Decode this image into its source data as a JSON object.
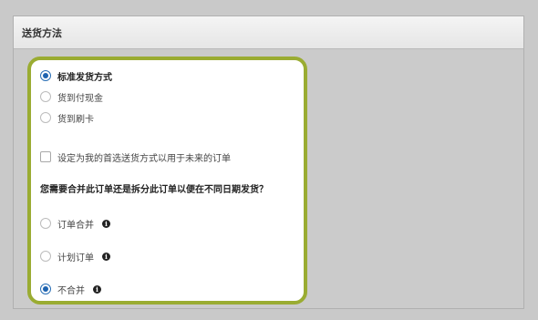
{
  "panel": {
    "title": "送货方法"
  },
  "shipping_options": [
    {
      "label": "标准发货方式",
      "checked": true
    },
    {
      "label": "货到付现金",
      "checked": false
    },
    {
      "label": "货到刷卡",
      "checked": false
    }
  ],
  "preferred_checkbox": {
    "label": "设定为我的首选送货方式以用于未来的订单",
    "checked": false
  },
  "split_question": "您需要合并此订单还是拆分此订单以便在不同日期发货？",
  "split_options": [
    {
      "label": "订单合并",
      "checked": false,
      "icon": "info-icon"
    },
    {
      "label": "计划订单",
      "checked": false,
      "icon": "info-icon"
    },
    {
      "label": "不合并",
      "checked": true,
      "icon": "info-icon"
    }
  ],
  "colors": {
    "accent_border": "#9aac32",
    "radio_checked": "#1e63b0"
  }
}
